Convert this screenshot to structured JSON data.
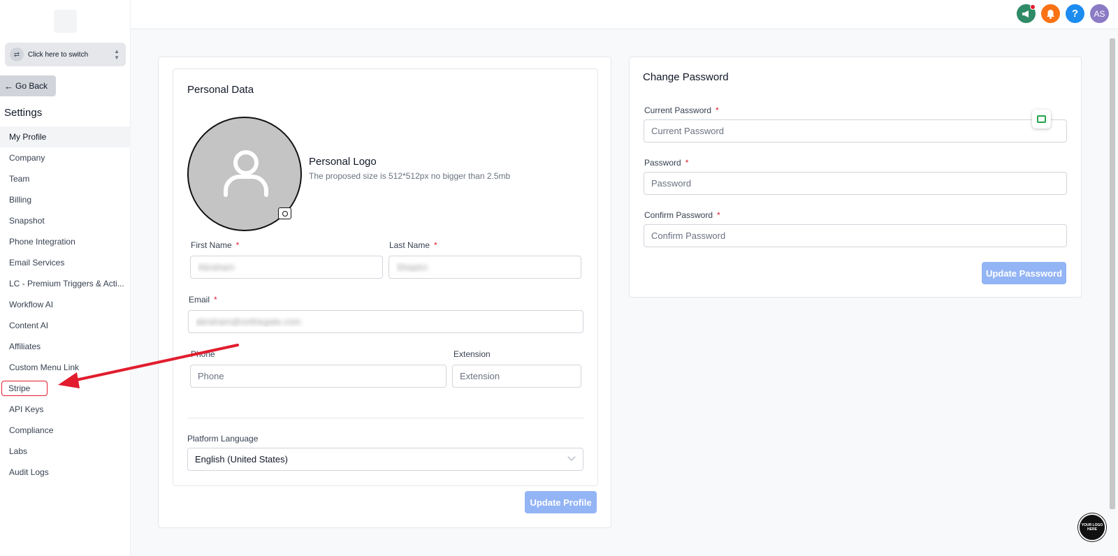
{
  "sidebar": {
    "switcher_label": "Click here to switch",
    "go_back": "Go Back",
    "settings_title": "Settings",
    "items": [
      {
        "label": "My Profile"
      },
      {
        "label": "Company"
      },
      {
        "label": "Team"
      },
      {
        "label": "Billing"
      },
      {
        "label": "Snapshot"
      },
      {
        "label": "Phone Integration"
      },
      {
        "label": "Email Services"
      },
      {
        "label": "LC - Premium Triggers & Acti..."
      },
      {
        "label": "Workflow AI"
      },
      {
        "label": "Content AI"
      },
      {
        "label": "Affiliates"
      },
      {
        "label": "Custom Menu Link"
      },
      {
        "label": "Stripe"
      },
      {
        "label": "API Keys"
      },
      {
        "label": "Compliance"
      },
      {
        "label": "Labs"
      },
      {
        "label": "Audit Logs"
      }
    ],
    "active_item": "My Profile",
    "highlighted_item": "Stripe"
  },
  "topbar": {
    "icons": [
      "megaphone-icon",
      "bell-icon",
      "help-icon",
      "avatar"
    ],
    "help_glyph": "?",
    "avatar_initials": "AS",
    "colors": {
      "megaphone": "#2f8a68",
      "bell": "#f97316",
      "help": "#1d8cf0",
      "avatar": "#8b7bc4"
    }
  },
  "personal": {
    "title": "Personal Data",
    "logo_title": "Personal Logo",
    "logo_hint": "The proposed size is 512*512px no bigger than 2.5mb",
    "first_name_label": "First Name",
    "first_name_value": "Abraham",
    "last_name_label": "Last Name",
    "last_name_value": "Shapiro",
    "email_label": "Email",
    "email_value": "abraham@onthegate.com",
    "phone_label": "Phone",
    "phone_placeholder": "Phone",
    "extension_label": "Extension",
    "extension_placeholder": "Extension",
    "language_label": "Platform Language",
    "language_value": "English (United States)",
    "update_button": "Update Profile",
    "required_mark": "*"
  },
  "password": {
    "title": "Change Password",
    "current_label": "Current Password",
    "current_placeholder": "Current Password",
    "password_label": "Password",
    "password_placeholder": "Password",
    "confirm_label": "Confirm Password",
    "confirm_placeholder": "Confirm Password",
    "update_button": "Update Password"
  },
  "widget": {
    "logo_text": "YOUR LOGO HERE"
  },
  "colors": {
    "accent_button": "#93b4f5",
    "required": "#e11d2e",
    "annotation_arrow": "#e11d2e"
  }
}
